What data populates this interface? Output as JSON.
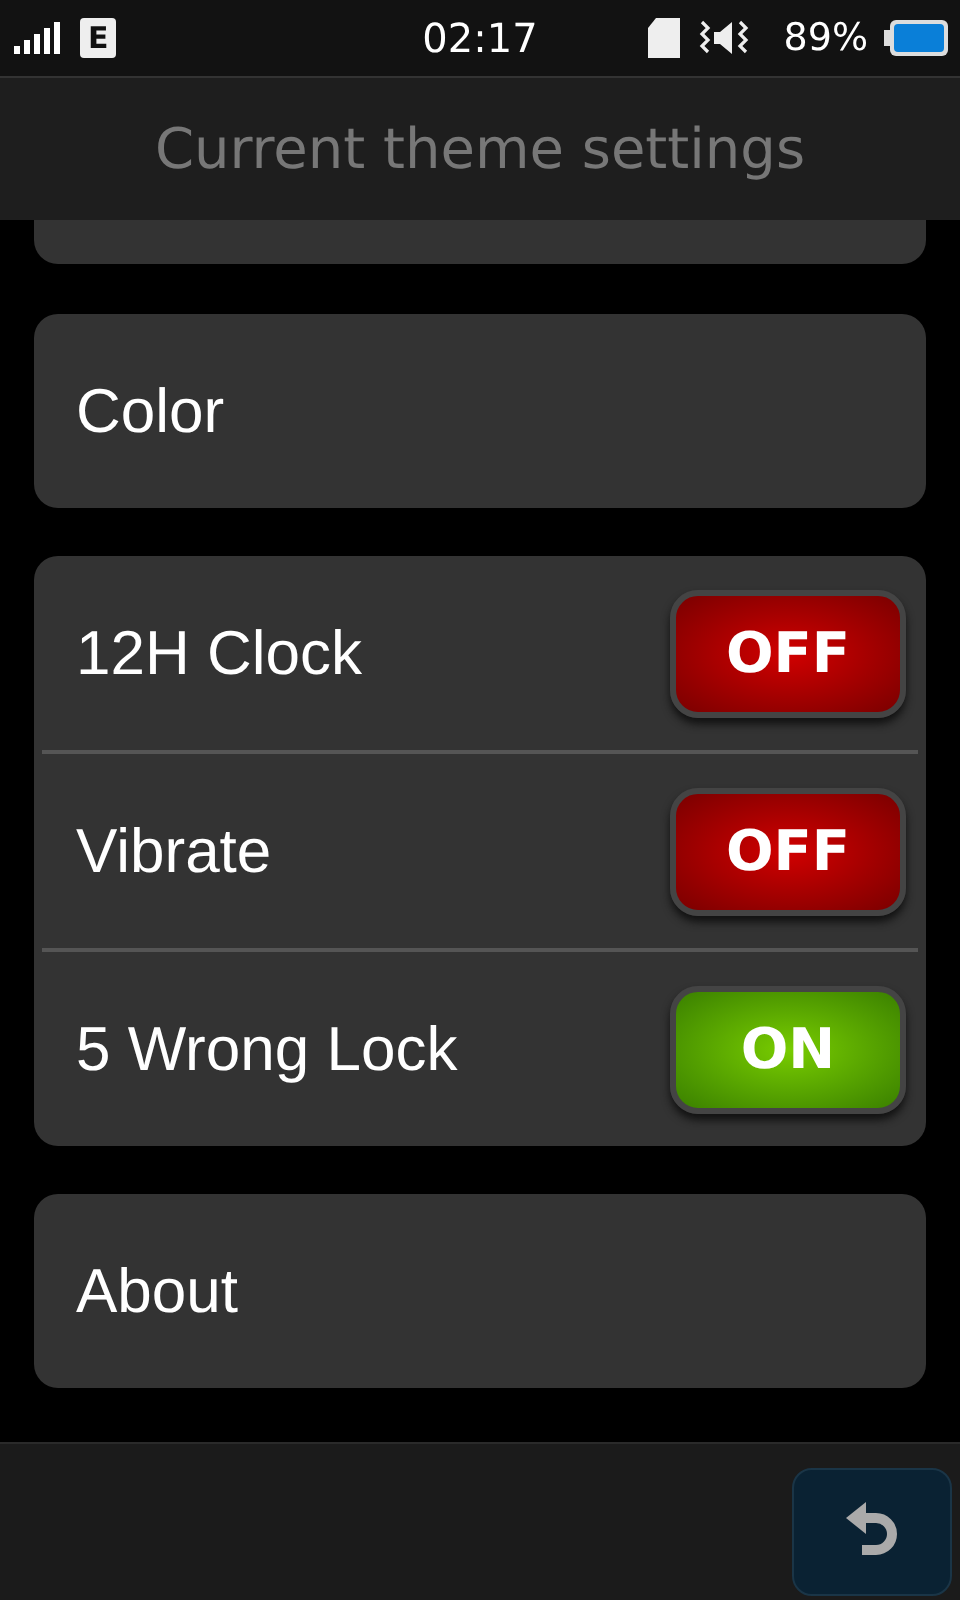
{
  "status_bar": {
    "network": "E",
    "time": "02:17",
    "battery": "89%"
  },
  "title": "Current theme settings",
  "sections": [
    {
      "items": [
        {
          "kind": "link",
          "label": "Color"
        }
      ]
    },
    {
      "items": [
        {
          "kind": "toggle",
          "label": "12H Clock",
          "on": false,
          "switch_text": "OFF"
        },
        {
          "kind": "toggle",
          "label": "Vibrate",
          "on": false,
          "switch_text": "OFF"
        },
        {
          "kind": "toggle",
          "label": "5 Wrong Lock",
          "on": true,
          "switch_text": "ON"
        }
      ]
    },
    {
      "items": [
        {
          "kind": "link",
          "label": "About"
        }
      ]
    }
  ]
}
